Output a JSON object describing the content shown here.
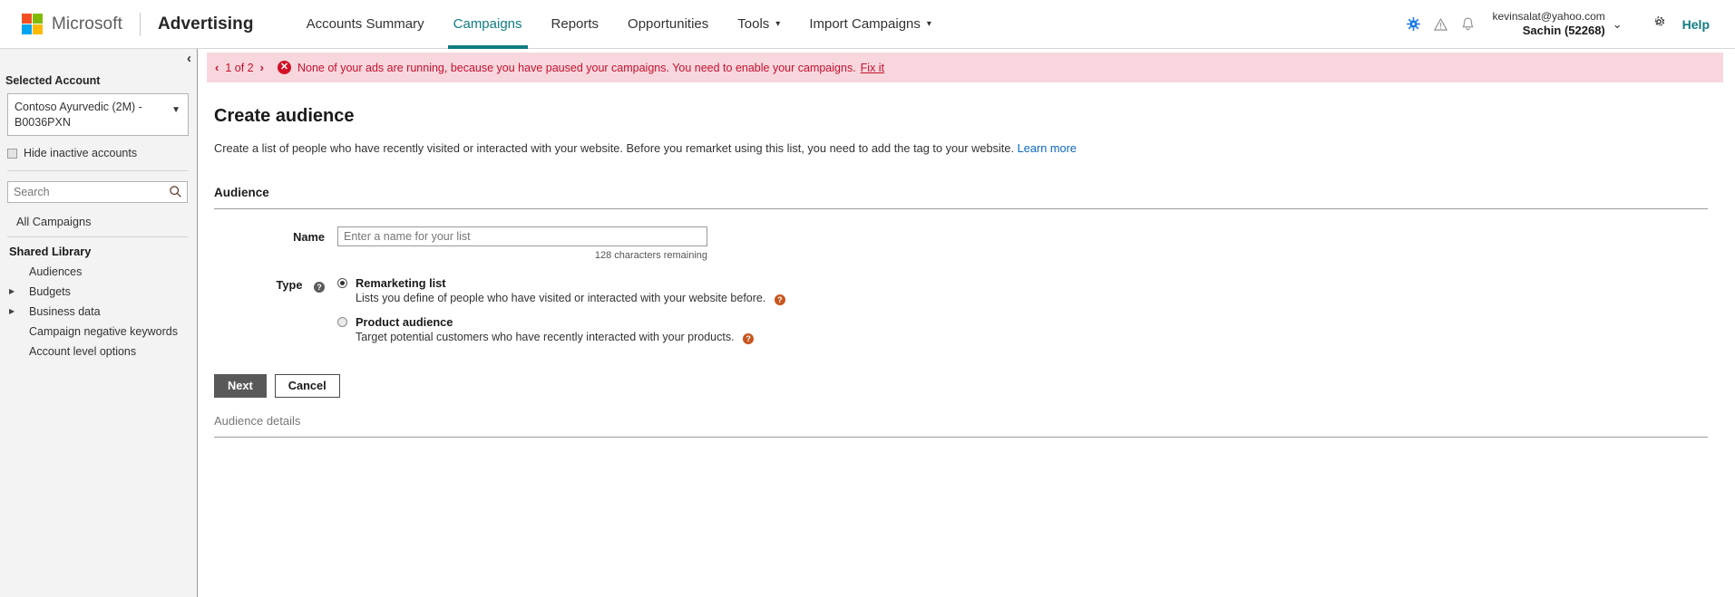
{
  "header": {
    "brand": "Microsoft",
    "product": "Advertising",
    "nav": [
      {
        "label": "Accounts Summary",
        "active": false,
        "caret": false
      },
      {
        "label": "Campaigns",
        "active": true,
        "caret": false
      },
      {
        "label": "Reports",
        "active": false,
        "caret": false
      },
      {
        "label": "Opportunities",
        "active": false,
        "caret": false
      },
      {
        "label": "Tools",
        "active": false,
        "caret": true
      },
      {
        "label": "Import Campaigns",
        "active": false,
        "caret": true
      }
    ],
    "caret_glyph": "▾",
    "account_email": "kevinsalat@yahoo.com",
    "account_name": "Sachin (52268)",
    "account_caret": "⌄",
    "help_label": "Help",
    "accent_teal": "#107c82",
    "logo_colors": [
      "#f25022",
      "#7fba00",
      "#00a4ef",
      "#ffb900"
    ]
  },
  "sidebar": {
    "collapse_glyph": "‹",
    "selected_account_label": "Selected Account",
    "selected_account_value": "Contoso Ayurvedic (2M) - B0036PXN",
    "dropdown_caret": "▼",
    "hide_inactive_label": "Hide inactive accounts",
    "search_placeholder": "Search",
    "all_campaigns": "All Campaigns",
    "shared_library": "Shared Library",
    "items": [
      {
        "label": "Audiences",
        "expandable": false
      },
      {
        "label": "Budgets",
        "expandable": true
      },
      {
        "label": "Business data",
        "expandable": true
      },
      {
        "label": "Campaign negative keywords",
        "expandable": false
      },
      {
        "label": "Account level options",
        "expandable": false
      }
    ],
    "expander_glyph": "▶"
  },
  "alert": {
    "prev_glyph": "‹",
    "next_glyph": "›",
    "pager": "1 of 2",
    "icon_glyph": "✕",
    "message": "None of your ads are running, because you have paused your campaigns. You need to enable your campaigns.",
    "fix_label": "Fix it",
    "bg_color": "#f7d7dd",
    "text_color": "#c8102e"
  },
  "main": {
    "title": "Create audience",
    "subtitle": "Create a list of people who have recently visited or interacted with your website. Before you remarket using this list, you need to add the tag to your website.",
    "learn_more": "Learn more",
    "section_title": "Audience",
    "name_label": "Name",
    "name_value": "",
    "name_placeholder": "Enter a name for your list",
    "chars_remaining": "128 characters remaining",
    "type_label": "Type",
    "help_glyph": "?",
    "radios": [
      {
        "title": "Remarketing list",
        "desc": "Lists you define of people who have visited or interacted with your website before.",
        "selected": true
      },
      {
        "title": "Product audience",
        "desc": "Target potential customers who have recently interacted with your products.",
        "selected": false
      }
    ],
    "next_label": "Next",
    "cancel_label": "Cancel",
    "details_label": "Audience details"
  }
}
